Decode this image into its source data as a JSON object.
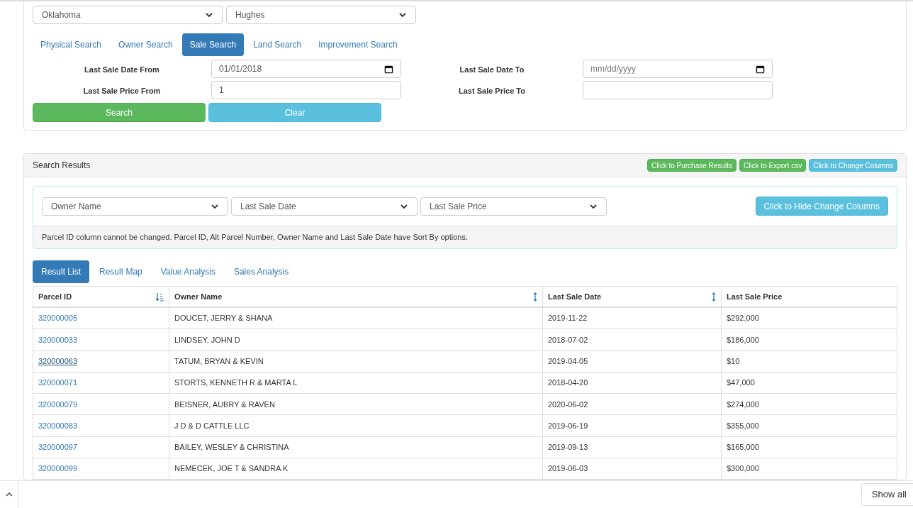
{
  "location": {
    "state": "Oklahoma",
    "county": "Hughes"
  },
  "search_tabs": [
    {
      "label": "Physical Search",
      "selected": false
    },
    {
      "label": "Owner Search",
      "selected": false
    },
    {
      "label": "Sale Search",
      "selected": true
    },
    {
      "label": "Land Search",
      "selected": false
    },
    {
      "label": "Improvement Search",
      "selected": false
    }
  ],
  "form_rows": [
    {
      "label_from": "Last Sale Date From",
      "kind": "date",
      "value_from": "01/01/2018",
      "label_to": "Last Sale Date To",
      "placeholder_to": "mm/dd/yyyy"
    },
    {
      "label_from": "Last Sale Price From",
      "kind": "text",
      "value_from": "1",
      "label_to": "Last Sale Price To"
    }
  ],
  "form_buttons": [
    {
      "label": "Search",
      "kind": "success"
    },
    {
      "label": "Clear",
      "kind": "info"
    }
  ],
  "results": {
    "title": "Search Results",
    "actions": [
      {
        "label": "Click to Purchase Results",
        "kind": "success"
      },
      {
        "label": "Click to Export csv",
        "kind": "success"
      },
      {
        "label": "Click to Change Columns",
        "kind": "info"
      }
    ],
    "column_selects": [
      "Owner Name",
      "Last Sale Date",
      "Last Sale Price"
    ],
    "hide_button": "Click to Hide Change Columns",
    "note": "Parcel ID column cannot be changed. Parcel ID, Alt Parcel Number, Owner Name and Last Sale Date have Sort By options.",
    "tabs": [
      {
        "label": "Result List",
        "selected": true
      },
      {
        "label": "Result Map",
        "selected": false
      },
      {
        "label": "Value Analysis",
        "selected": false
      },
      {
        "label": "Sales Analysis",
        "selected": false
      }
    ],
    "table": {
      "columns": [
        {
          "label": "Parcel ID",
          "kind": "ascending"
        },
        {
          "label": "Owner Name",
          "kind": "sortable"
        },
        {
          "label": "Last Sale Date",
          "kind": "sortable"
        },
        {
          "label": "Last Sale Price",
          "kind": "plain"
        }
      ],
      "rows": [
        {
          "parcel_id": "320000005",
          "hovered": false,
          "owner": "DOUCET, JERRY & SHANA",
          "date": "2019-11-22",
          "price": "$292,000"
        },
        {
          "parcel_id": "320000033",
          "hovered": false,
          "owner": "LINDSEY, JOHN D",
          "date": "2018-07-02",
          "price": "$186,000"
        },
        {
          "parcel_id": "320000063",
          "hovered": true,
          "owner": "TATUM, BRYAN & KEVIN",
          "date": "2019-04-05",
          "price": "$10"
        },
        {
          "parcel_id": "320000071",
          "hovered": false,
          "owner": "STORTS, KENNETH R & MARTA L",
          "date": "2018-04-20",
          "price": "$47,000"
        },
        {
          "parcel_id": "320000079",
          "hovered": false,
          "owner": "BEISNER, AUBRY & RAVEN",
          "date": "2020-06-02",
          "price": "$274,000"
        },
        {
          "parcel_id": "320000083",
          "hovered": false,
          "owner": "J D & D CATTLE LLC",
          "date": "2019-06-19",
          "price": "$355,000"
        },
        {
          "parcel_id": "320000097",
          "hovered": false,
          "owner": "BAILEY, WESLEY & CHRISTINA",
          "date": "2019-09-13",
          "price": "$165,000"
        },
        {
          "parcel_id": "320000099",
          "hovered": false,
          "owner": "NEMECEK, JOE T & SANDRA K",
          "date": "2019-06-03",
          "price": "$300,000"
        }
      ]
    }
  },
  "download_bar": {
    "show_all": "Show all"
  }
}
